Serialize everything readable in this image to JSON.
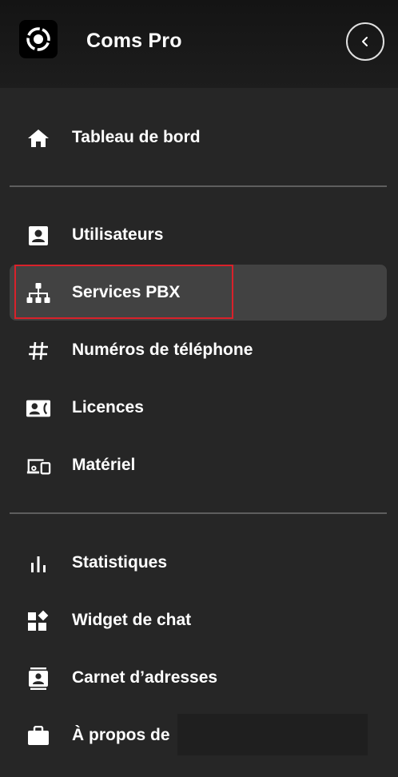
{
  "header": {
    "title": "Coms Pro",
    "logo_icon": "ring-logo-icon",
    "collapse_icon": "chevron-left-icon"
  },
  "nav": {
    "groups": [
      [
        {
          "label": "Tableau de bord",
          "icon": "home-icon"
        }
      ],
      [
        {
          "label": "Utilisateurs",
          "icon": "person-badge-icon"
        },
        {
          "label": "Services PBX",
          "icon": "sitemap-icon",
          "active": true
        },
        {
          "label": "Numéros de téléphone",
          "icon": "hash-icon"
        },
        {
          "label": "Licences",
          "icon": "contact-card-icon"
        },
        {
          "label": "Matériel",
          "icon": "devices-icon"
        }
      ],
      [
        {
          "label": "Statistiques",
          "icon": "bar-chart-icon"
        },
        {
          "label": "Widget de chat",
          "icon": "widgets-icon"
        },
        {
          "label": "Carnet d’adresses",
          "icon": "address-book-icon"
        },
        {
          "label": "À propos de",
          "icon": "briefcase-icon"
        }
      ]
    ]
  },
  "colors": {
    "background": "#262626",
    "header": "#171717",
    "active_item": "#424242",
    "highlight_border": "#d9212a",
    "text": "#ffffff"
  }
}
